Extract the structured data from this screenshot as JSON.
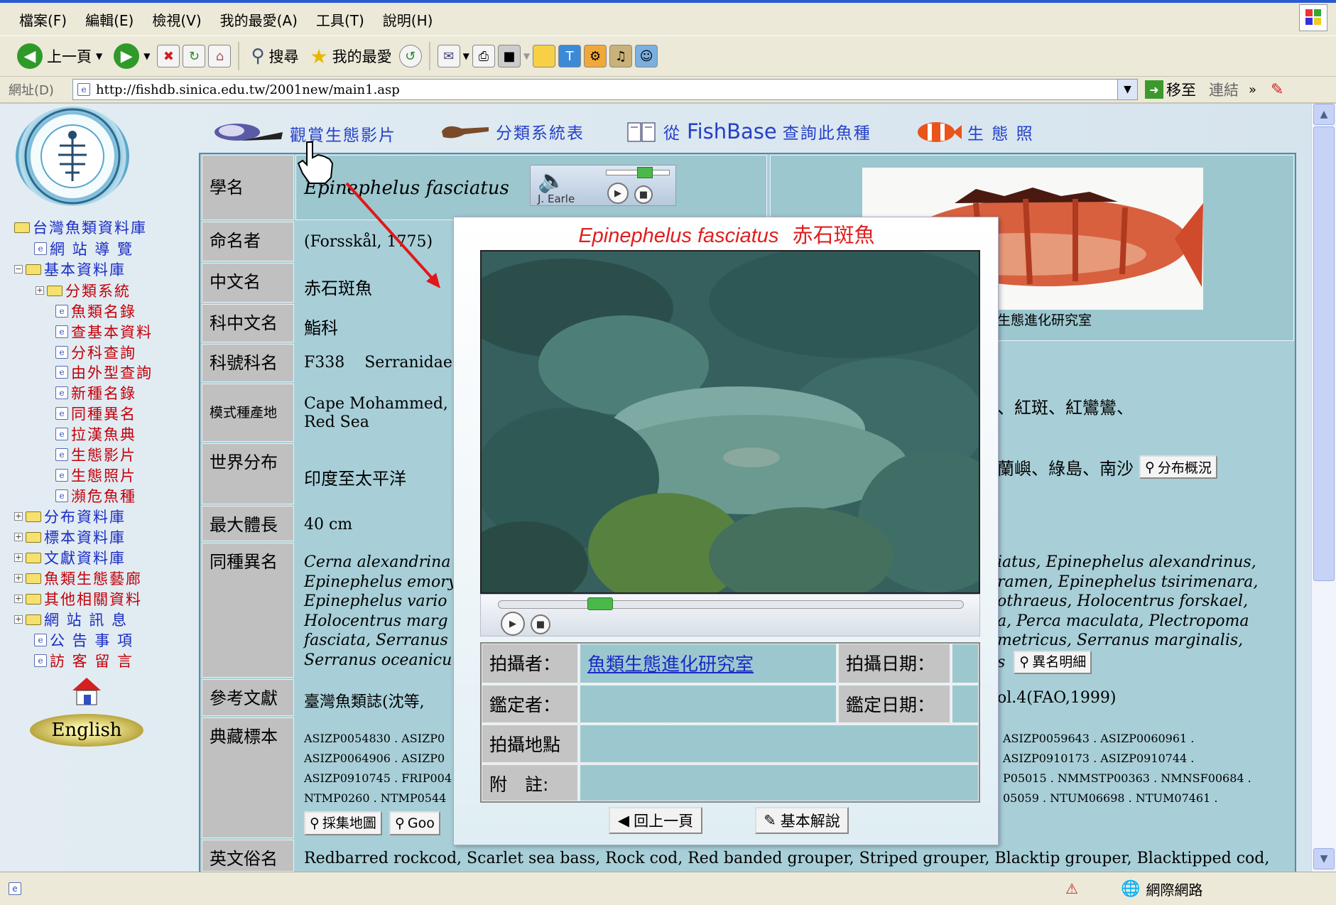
{
  "menu": [
    "檔案(F)",
    "編輯(E)",
    "檢視(V)",
    "我的最愛(A)",
    "工具(T)",
    "說明(H)"
  ],
  "toolbar": {
    "back": "上一頁",
    "search": "搜尋",
    "favorites": "我的最愛"
  },
  "address": {
    "label": "網址(D)",
    "url": "http://fishdb.sinica.edu.tw/2001new/main1.asp",
    "go": "移至",
    "links": "連結"
  },
  "status": {
    "zone": "網際網路"
  },
  "nav": {
    "root": "台灣魚類資料庫",
    "items": [
      {
        "label": "網 站 導 覽"
      },
      {
        "label": "基本資料庫"
      },
      {
        "label": "分類系統"
      },
      {
        "label": "魚類名錄"
      },
      {
        "label": "查基本資料"
      },
      {
        "label": "分科查詢"
      },
      {
        "label": "由外型查詢"
      },
      {
        "label": "新種名錄"
      },
      {
        "label": "同種異名"
      },
      {
        "label": "拉漢魚典"
      },
      {
        "label": "生態影片"
      },
      {
        "label": "生態照片"
      },
      {
        "label": "瀕危魚種"
      },
      {
        "label": "分布資料庫"
      },
      {
        "label": "標本資料庫"
      },
      {
        "label": "文獻資料庫"
      },
      {
        "label": "魚類生態藝廊"
      },
      {
        "label": "其他相關資料"
      },
      {
        "label": "網 站 訊 息"
      },
      {
        "label": "公 告 事 項"
      },
      {
        "label": "訪 客 留 言"
      }
    ],
    "english": "English"
  },
  "toplinks": {
    "video": "觀賞生態影片",
    "taxonomy": "分類系統表",
    "fishbase_pre": "從",
    "fishbase": "FishBase",
    "fishbase_post": "查詢此魚種",
    "photo": "生 態 照"
  },
  "labels": {
    "sci": "學名",
    "author": "命名者",
    "cname": "中文名",
    "family_c": "科中文名",
    "family": "科號科名",
    "type_loc": "模式種產地",
    "world": "世界分布",
    "maxlen": "最大體長",
    "synonym": "同種異名",
    "ref": "參考文獻",
    "specimen": "典藏標本",
    "en_name": "英文俗名"
  },
  "values": {
    "sci": "Epinephelus fasciatus",
    "audio_credit": "J. Earle",
    "author": "(Forsskål, 1775)",
    "cname": "赤石斑魚",
    "family_c": "鮨科",
    "family": "F338    Serranidae",
    "type_loc_1": "Cape Mohammed,",
    "type_loc_2": "Red Sea",
    "other_names": "、紅斑、紅鸞鸞、",
    "world": "印度至太平洋",
    "world_right": "蘭嶼、綠島、南沙",
    "dist_btn": "分布概況",
    "maxlen": "40 cm",
    "syn_left": [
      "Cerna alexandrina",
      "Epinephelus emory",
      "Epinephelus vario",
      "Holocentrus marg",
      "fasciata, Serranus",
      "Serranus oceanicu"
    ],
    "syn_right": [
      "iatus, Epinephelus alexandrinus,",
      "ramen, Epinephelus tsirimenara,",
      "othraeus, Holocentrus forskael,",
      "a, Perca maculata, Plectropoma",
      "metricus, Serranus marginalis,",
      "s"
    ],
    "syn_btn": "異名明細",
    "ref_left": "臺灣魚類誌(沈等,",
    "ref_right": "ol.4(FAO,1999)",
    "spec_left": [
      "ASIZP0054830 . ASIZP0",
      "ASIZP0064906 . ASIZP0",
      "ASIZP0910745 . FRIP004",
      "NTMP0260 . NTMP0544"
    ],
    "spec_right": [
      "ASIZP0059643 . ASIZP0060961 .",
      "ASIZP0910173 . ASIZP0910744 .",
      "P05015 . NMMSTP00363 . NMNSF00684 .",
      "05059 . NTUM06698 . NTUM07461 ."
    ],
    "map_btn": "採集地圖",
    "goo_btn": "Goo",
    "photo_credit": "生態進化研究室",
    "en_name": "Redbarred rockcod, Scarlet sea bass, Rock cod, Red banded grouper, Striped grouper, Blacktip grouper, Blacktipped cod,"
  },
  "popup": {
    "title_sci": "Epinephelus fasciatus",
    "title_cn": "赤石斑魚",
    "photographer_lbl": "拍攝者：",
    "photographer": "魚類生態進化研究室",
    "date_lbl": "拍攝日期：",
    "identifier_lbl": "鑑定者：",
    "id_date_lbl": "鑑定日期：",
    "place_lbl": "拍攝地點",
    "note_lbl": "附　註:",
    "back_btn": "回上一頁",
    "basic_btn": "基本解說"
  }
}
